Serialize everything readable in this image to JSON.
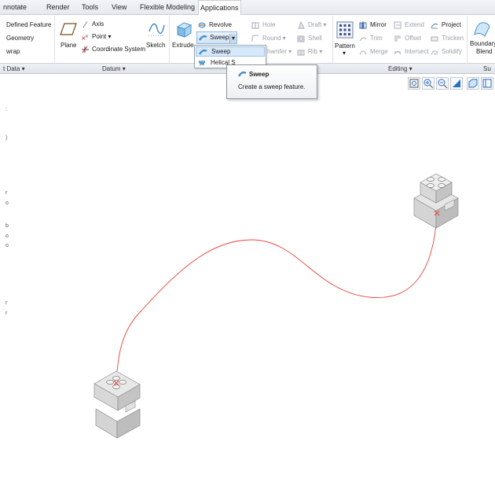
{
  "menu": {
    "tabs": [
      "nnotate",
      "Render",
      "Tools",
      "View",
      "Flexible Modeling",
      "Applications"
    ]
  },
  "ribbon": {
    "get_data": {
      "defined_feature": "Defined Feature",
      "geometry": "Geometry",
      "wrap": "wrap",
      "group_label": "t Data ▾"
    },
    "datum": {
      "plane": "Plane",
      "axis": "Axis",
      "point": "Point ▾",
      "csys": "Coordinate System",
      "sketch": "Sketch",
      "group_label": "Datum ▾"
    },
    "shapes": {
      "extrude": "Extrude",
      "revolve": "Revolve",
      "sweep": "Sweep",
      "sweep_arrow": "▾"
    },
    "engineering": {
      "hole": "Hole",
      "round": "Round ▾",
      "chamfer": "hamfer ▾",
      "draft": "Draft ▾",
      "shell": "Shell",
      "rib": "Rib ▾"
    },
    "editing": {
      "pattern": "Pattern",
      "pattern_arrow": "▾",
      "mirror": "Mirror",
      "trim": "Trim",
      "merge": "Merge",
      "extend": "Extend",
      "offset": "Offset",
      "intersect": "Intersect",
      "project": "Project",
      "thicken": "Thicken",
      "solidify": "Solidify",
      "group_label": "Editing ▾"
    },
    "surfaces": {
      "boundary_line1": "Boundary",
      "boundary_line2": "Blend",
      "group_label": "Su"
    }
  },
  "dropdown": {
    "items": [
      "Sweep",
      "Helical S"
    ]
  },
  "tooltip": {
    "title": "Sweep",
    "description": "Create a sweep feature."
  },
  "left_edge": [
    ":",
    ")",
    "r",
    "o",
    "b",
    "o",
    "o",
    "r",
    "r"
  ],
  "colors": {
    "accent": "#d6e8f9",
    "trajectory": "#e8423c",
    "model_face": "#dcdcdc"
  }
}
